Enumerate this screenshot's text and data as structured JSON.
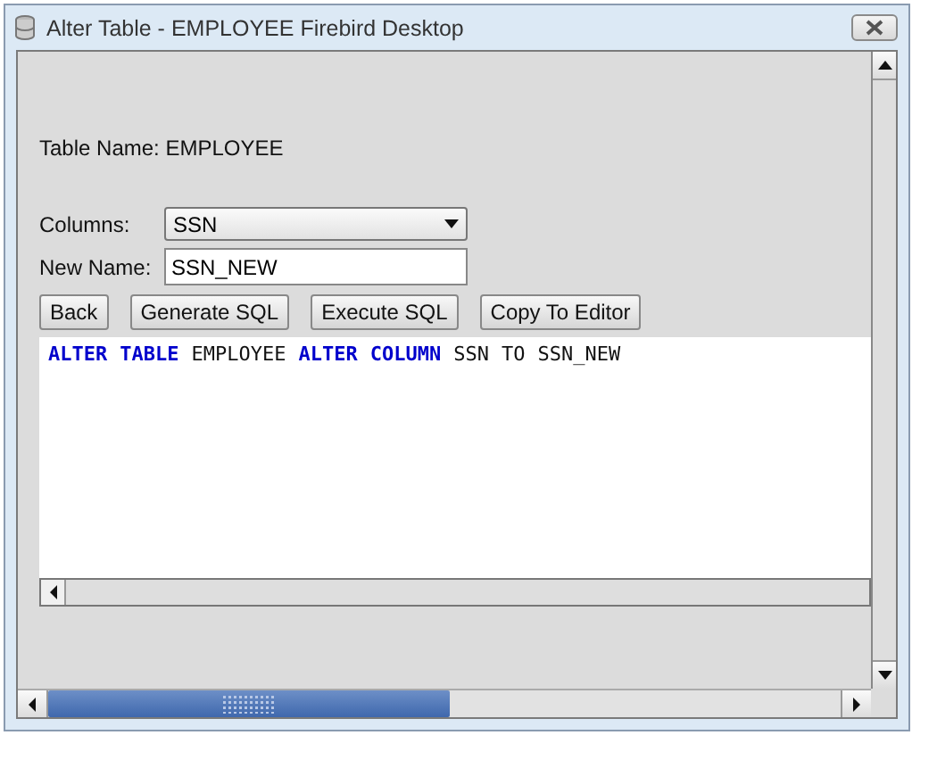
{
  "window": {
    "title": "Alter Table - EMPLOYEE Firebird Desktop"
  },
  "table_name": "Table Name: EMPLOYEE",
  "columns": {
    "label": "Columns:",
    "value": "SSN"
  },
  "new_name": {
    "label": "New Name:",
    "value": "SSN_NEW"
  },
  "buttons": [
    "Back",
    "Generate SQL",
    "Execute SQL",
    "Copy To Editor"
  ],
  "sql": [
    {
      "text": "ALTER",
      "kind": "keyword"
    },
    {
      "text": "TABLE",
      "kind": "keyword"
    },
    {
      "text": "EMPLOYEE",
      "kind": "plain"
    },
    {
      "text": "ALTER",
      "kind": "keyword"
    },
    {
      "text": "COLUMN",
      "kind": "keyword"
    },
    {
      "text": "SSN",
      "kind": "plain"
    },
    {
      "text": "TO",
      "kind": "plain"
    },
    {
      "text": "SSN_NEW",
      "kind": "plain"
    }
  ]
}
